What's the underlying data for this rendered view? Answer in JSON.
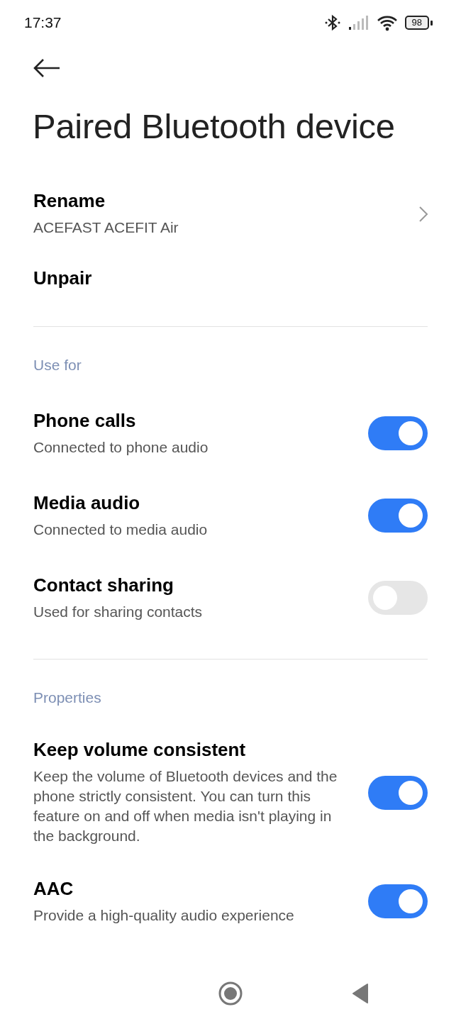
{
  "status_bar": {
    "time": "17:37",
    "battery": "98"
  },
  "title": "Paired Bluetooth device",
  "device_actions": [
    {
      "kind": "link",
      "label": "Rename",
      "value": "ACEFAST ACEFIT Air"
    },
    {
      "kind": "action",
      "label": "Unpair"
    }
  ],
  "sections": [
    {
      "header": "Use for",
      "items": [
        {
          "label": "Phone calls",
          "description": "Connected to phone audio",
          "on": true
        },
        {
          "label": "Media audio",
          "description": "Connected to media audio",
          "on": true
        },
        {
          "label": "Contact sharing",
          "description": "Used for sharing contacts",
          "on": false
        }
      ]
    },
    {
      "header": "Properties",
      "items": [
        {
          "label": "Keep volume consistent",
          "description": "Keep the volume of Bluetooth devices and the phone strictly consistent. You can turn this feature on and off when media isn't playing in the background.",
          "on": true
        },
        {
          "label": "AAC",
          "description": "Provide a high-quality audio experience",
          "on": true
        }
      ]
    }
  ]
}
